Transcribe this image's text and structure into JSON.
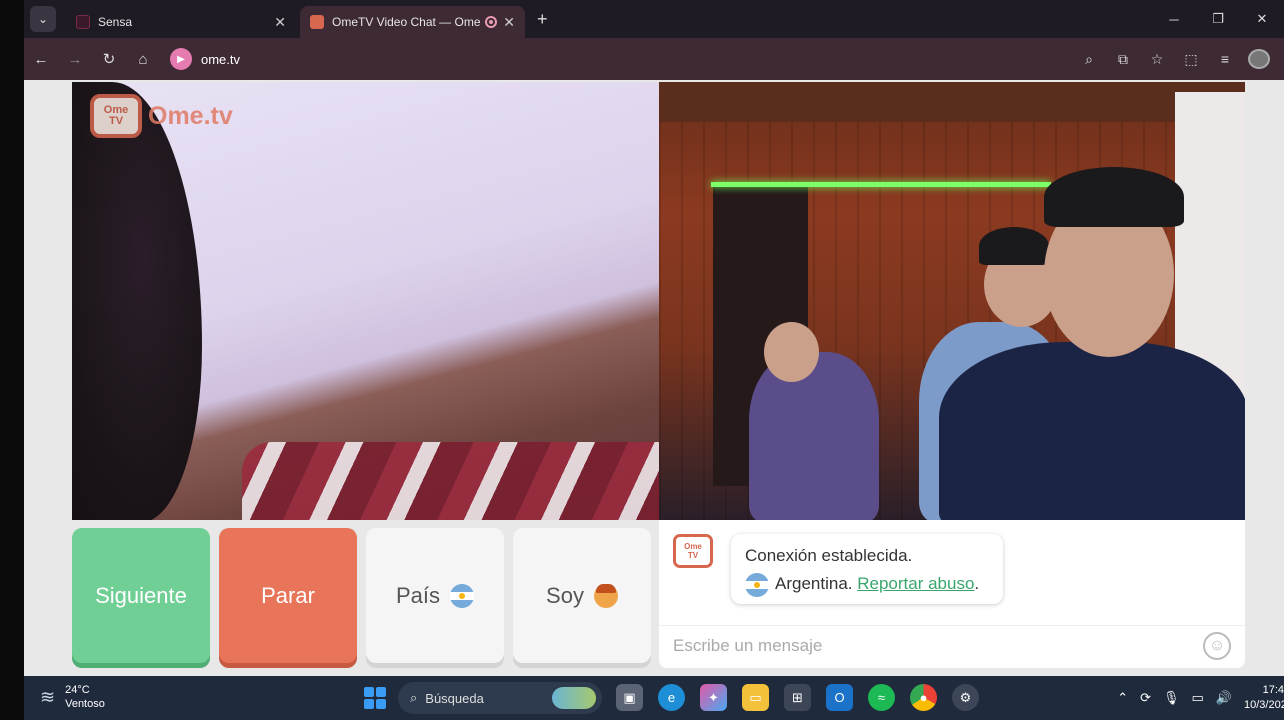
{
  "browser": {
    "tabs": [
      {
        "title": "Sensa",
        "active": false
      },
      {
        "title": "OmeTV Video Chat — Ome",
        "active": true
      }
    ],
    "url": "ome.tv",
    "favicon_color": "#e57bb0"
  },
  "page": {
    "logo": {
      "tv_line1": "Ome",
      "tv_line2": "TV",
      "text": "Ome.tv"
    },
    "buttons": {
      "next": "Siguiente",
      "stop": "Parar",
      "country": "País",
      "me": "Soy"
    },
    "chat": {
      "line1": "Conexión establecida.",
      "country": "Argentina.",
      "report": "Reportar abuso",
      "report_suffix": ".",
      "placeholder": "Escribe un mensaje"
    },
    "colors": {
      "next": "#6fcf94",
      "stop": "#e8745a",
      "brand": "#d8674f",
      "link": "#3aa56b"
    }
  },
  "taskbar": {
    "weather_temp": "24°C",
    "weather_desc": "Ventoso",
    "search_label": "Búsqueda",
    "time": "17:4",
    "date": "10/3/202"
  }
}
